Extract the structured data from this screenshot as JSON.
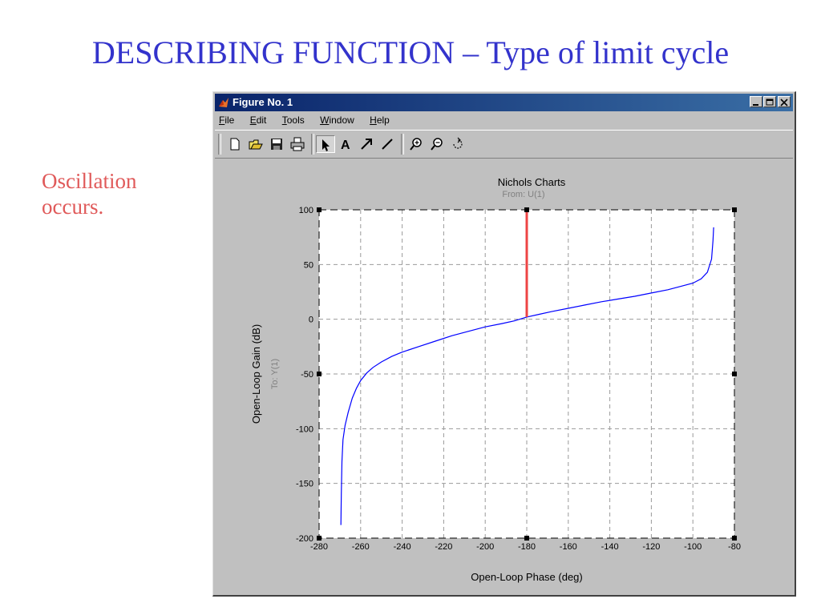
{
  "slide": {
    "title": "DESCRIBING FUNCTION – Type of limit cycle",
    "note_lines": [
      "Oscillation",
      "occurs."
    ]
  },
  "window": {
    "title": "Figure No. 1",
    "menu": [
      {
        "u": "F",
        "rest": "ile"
      },
      {
        "u": "E",
        "rest": "dit"
      },
      {
        "u": "T",
        "rest": "ools"
      },
      {
        "u": "W",
        "rest": "indow"
      },
      {
        "u": "H",
        "rest": "elp"
      }
    ],
    "toolbar": [
      "new-file-icon",
      "open-folder-icon",
      "save-icon",
      "print-icon",
      "pointer-icon",
      "text-tool-icon",
      "arrow-tool-icon",
      "line-tool-icon",
      "zoom-in-icon",
      "zoom-out-icon",
      "rotate-icon"
    ]
  },
  "chart_data": {
    "type": "line",
    "title": "Nichols Charts",
    "subtitle": "From: U(1)",
    "xlabel": "Open-Loop Phase (deg)",
    "ylabel": "Open-Loop Gain (dB)",
    "ylabel2": "To: Y(1)",
    "xlim": [
      -280,
      -80
    ],
    "ylim": [
      -200,
      100
    ],
    "xticks": [
      -280,
      -260,
      -240,
      -220,
      -200,
      -180,
      -160,
      -140,
      -120,
      -100,
      -80
    ],
    "yticks": [
      -200,
      -150,
      -100,
      -50,
      0,
      50,
      100
    ],
    "grid": true,
    "series": [
      {
        "color": "#0000ff",
        "x": [
          -269.5,
          -269.3,
          -269,
          -268.5,
          -267.5,
          -266,
          -264,
          -262,
          -260,
          -257,
          -254,
          -250,
          -245,
          -240,
          -232,
          -224,
          -216,
          -208,
          -200,
          -192,
          -186,
          -180,
          -174,
          -168,
          -160,
          -152,
          -144,
          -136,
          -128,
          -120,
          -112,
          -106,
          -100,
          -96,
          -93,
          -91,
          -90.3,
          -90
        ],
        "y": [
          -188,
          -160,
          -130,
          -110,
          -97,
          -85,
          -72,
          -63,
          -56,
          -49,
          -44,
          -39,
          -34,
          -30,
          -25,
          -20,
          -15,
          -11,
          -7,
          -4,
          -1.5,
          2,
          4.5,
          7,
          10,
          13,
          16,
          18.5,
          21,
          24,
          27,
          30,
          33,
          37,
          43,
          55,
          72,
          84
        ]
      },
      {
        "color": "#ee4444",
        "x": [
          -180,
          -180
        ],
        "y": [
          2,
          100
        ]
      }
    ]
  }
}
